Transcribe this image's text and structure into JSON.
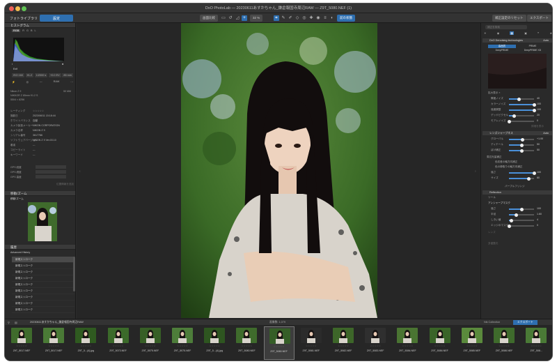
{
  "window": {
    "title": "DxO PhotoLab — 20230611あすかちゃん_鎌倉報国寺周辺RAW — Z9T_5080.NEF (1)"
  },
  "toolbar": {
    "tab_library": "フォトライブラリ",
    "tab_customize": "設定",
    "compare_btn": "画面比較",
    "zoom_value": "32 %",
    "flip_btn": "前の状態",
    "reset_btn": "補正設定のリセット",
    "export_btn": "エクスポート"
  },
  "left": {
    "histogram_title": "ヒストグラム",
    "hist_channels": [
      "RGB",
      "R",
      "G",
      "B",
      "L"
    ],
    "exif_label": "Exif",
    "exif_values": [
      "ISO 160",
      "f/1.2",
      "1/2000 s",
      "+0.0 EV",
      "85 mm"
    ],
    "lens_model": "NIKKOR Z 85mm f/1.2 S",
    "camera": "Nikon Z 9",
    "size": "5504 × 8256",
    "focal": "50 MM",
    "meta_rows": [
      {
        "k": "レーティング",
        "v": "☆☆☆☆☆"
      },
      {
        "k": "撮影日",
        "v": "2023/06/11 15:18:44"
      },
      {
        "k": "ホワイトバランス",
        "v": "自動"
      },
      {
        "k": "カメラ製造メーカー",
        "v": "NIKON CORPORATION"
      },
      {
        "k": "カメラ名称",
        "v": "NIKON Z 9"
      },
      {
        "k": "シリアル番号",
        "v": "3617786"
      },
      {
        "k": "ソフトウェアバージョン",
        "v": "NIKON Z 9 Ver.03.10"
      },
      {
        "k": "著者",
        "v": "---"
      },
      {
        "k": "コピーライト",
        "v": "---"
      },
      {
        "k": "キーワード",
        "v": "---"
      }
    ],
    "gps_rows": [
      "GPS 経度",
      "GPS 緯度",
      "GPS 高度"
    ],
    "gps_link": "位置情報を追加",
    "preview_title": "移動/ズーム",
    "preview_sub": "移動/ズーム",
    "history_title": "履歴",
    "history_sub": "Advanced History",
    "history_items": [
      "新規ストローク",
      "新規ストローク",
      "新規ストローク",
      "新規ストローク",
      "新規ストローク",
      "新規ストローク",
      "新規ストローク",
      "新規ストローク",
      "新規ストローク"
    ]
  },
  "right": {
    "search_placeholder": "補正を検索",
    "deepprime_title": "DxO Denoising technologies",
    "deepprime_mode": "Auto",
    "dp_opt1": "高品質",
    "dp_opt2": "PRIME",
    "dp_opt3": "DeepPRIME",
    "dp_opt4": "DeepPRIME XD",
    "preview_label": "拡大表示 ×",
    "sliders_a": [
      {
        "label": "輝度ノイズ",
        "value": "40",
        "pct": 0.4
      },
      {
        "label": "カラーノイズ",
        "value": "100",
        "pct": 1.0
      },
      {
        "label": "強度調整",
        "value": "100",
        "pct": 1.0
      },
      {
        "label": "デッドピクセル",
        "value": "20",
        "pct": 0.2
      },
      {
        "label": "モアレノイズ",
        "value": "0",
        "pct": 0.0
      }
    ],
    "detail_link": "詳細を表示",
    "lens_title": "レンズシャープネス",
    "lens_mode": "Auto",
    "sliders_b": [
      {
        "label": "グローバル",
        "value": "+1.00",
        "pct": 0.55
      },
      {
        "label": "ディテール",
        "value": "50",
        "pct": 0.5
      },
      {
        "label": "ぼけ補正",
        "value": "50",
        "pct": 0.5
      }
    ],
    "dist_label": "周辺光量補正",
    "chromatic_1": "色収差の軸方向補正",
    "chromatic_2": "色の縁取りの軸方向補正",
    "sliders_c": [
      {
        "label": "強さ",
        "value": "100",
        "pct": 1.0
      },
      {
        "label": "サイズ",
        "value": "80",
        "pct": 0.8
      }
    ],
    "purple_label": "パープルフリンジ",
    "reflect_title": "Reflection",
    "tool_label": "ツール",
    "unsharp_title": "アンシャープマスク",
    "sliders_d": [
      {
        "label": "強さ",
        "value": "100",
        "pct": 0.5
      },
      {
        "label": "半径",
        "value": "1.60",
        "pct": 0.3
      },
      {
        "label": "しきい値",
        "value": "4",
        "pct": 0.1
      },
      {
        "label": "エッジのマスク",
        "value": "0",
        "pct": 0.0
      }
    ],
    "misc_label_1": "レンズ",
    "misc_label_2": "多重露光"
  },
  "strip": {
    "folder": "20230611あすかちゃん_鎌倉報国寺周辺RAW",
    "count_label": "画像数: 1,079",
    "nik_label": "Nik Collection",
    "export_label": "エクスポート"
  },
  "thumbs": [
    {
      "name": "Z9T_5017.NEF",
      "stars": "☆☆☆☆☆"
    },
    {
      "name": "Z9T_5017.NEF",
      "stars": "☆☆☆☆☆"
    },
    {
      "name": "Z9T_5...(4).jpg",
      "stars": "☆☆☆☆☆"
    },
    {
      "name": "Z9T_5073.NEF",
      "stars": "☆☆☆☆☆"
    },
    {
      "name": "Z9T_5075.NEF",
      "stars": "☆☆☆☆☆"
    },
    {
      "name": "Z9T_5075.NEF",
      "stars": "☆☆☆☆☆"
    },
    {
      "name": "Z9T_5...(4).jpg",
      "stars": "☆☆☆☆☆"
    },
    {
      "name": "Z9T_5080.NEF",
      "stars": "☆☆☆☆☆"
    },
    {
      "name": "Z9T_5080.NEF",
      "stars": "☆☆☆☆☆"
    },
    {
      "name": "Z9T_5081.NEF",
      "stars": "☆☆☆☆☆"
    },
    {
      "name": "Z9T_5082.NEF",
      "stars": "☆☆☆☆☆"
    },
    {
      "name": "Z9T_5083.NEF",
      "stars": "☆☆☆☆☆"
    },
    {
      "name": "Z9T_5084.NEF",
      "stars": "☆☆☆☆☆"
    },
    {
      "name": "Z9T_5084.NEF",
      "stars": "☆☆☆☆☆"
    },
    {
      "name": "Z9T_5085.NEF",
      "stars": "☆☆☆☆☆"
    },
    {
      "name": "Z9T_5086.NEF",
      "stars": "☆☆☆☆☆"
    },
    {
      "name": "Z9T_508...",
      "stars": "☆☆☆☆☆"
    }
  ],
  "selected_thumb": 8
}
